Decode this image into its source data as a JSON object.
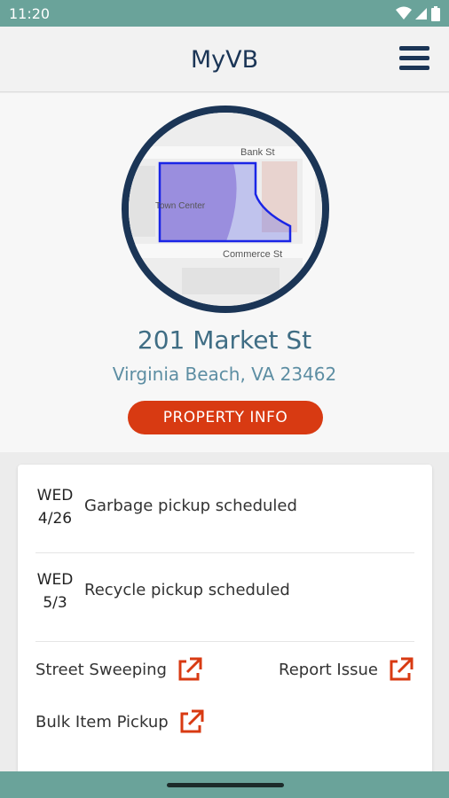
{
  "status_bar": {
    "time": "11:20"
  },
  "app_bar": {
    "title": "MyVB"
  },
  "map": {
    "labels": {
      "bank": "Bank St",
      "town": "Town Center",
      "commerce": "Commerce St"
    }
  },
  "property": {
    "street": "201 Market St",
    "city": "Virginia Beach, VA 23462",
    "button_label": "PROPERTY INFO"
  },
  "schedule": [
    {
      "day": "WED",
      "date": "4/26",
      "text": "Garbage pickup scheduled"
    },
    {
      "day": "WED",
      "date": "5/3",
      "text": "Recycle pickup scheduled"
    }
  ],
  "links": {
    "street_sweeping": "Street Sweeping",
    "report_issue": "Report Issue",
    "bulk_item": "Bulk Item Pickup"
  },
  "colors": {
    "brand_navy": "#1b3556",
    "accent_red": "#d83a12",
    "status_teal": "#6aa39a",
    "address_blue": "#3f6d84"
  }
}
